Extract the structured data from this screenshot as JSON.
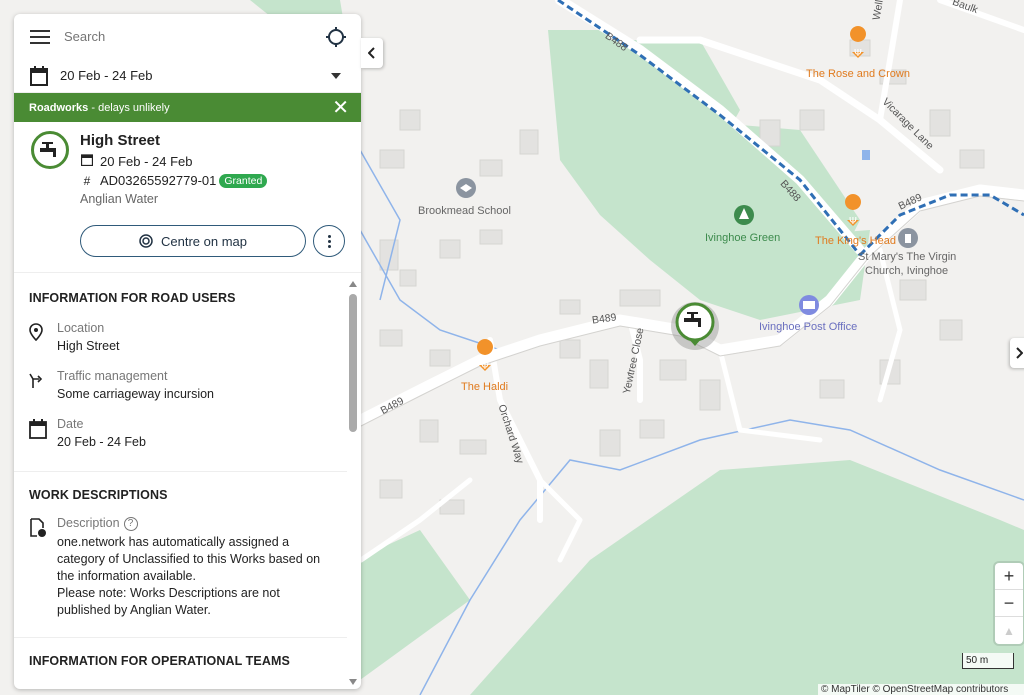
{
  "search": {
    "placeholder": "Search"
  },
  "date_filter": {
    "value": "20 Feb - 24 Feb"
  },
  "banner": {
    "title": "Roadworks",
    "subtitle": " - delays unlikely"
  },
  "works": {
    "street": "High Street",
    "dates": "20 Feb - 24 Feb",
    "reference": "AD03265592779-01",
    "status": "Granted",
    "company": "Anglian Water",
    "centre_button": "Centre on map"
  },
  "road_users": {
    "title": "INFORMATION FOR ROAD USERS",
    "location_label": "Location",
    "location_value": "High Street",
    "traffic_label": "Traffic management",
    "traffic_value": "Some carriageway incursion",
    "date_label": "Date",
    "date_value": "20 Feb - 24 Feb"
  },
  "work_descriptions": {
    "title": "WORK DESCRIPTIONS",
    "label": "Description",
    "help": "?",
    "text_1": "one.network has automatically assigned a category of Unclassified to this Works based on the information available.",
    "text_2": "Please note: Works Descriptions are not published by Anglian Water."
  },
  "operational": {
    "title": "INFORMATION FOR OPERATIONAL TEAMS"
  },
  "map": {
    "labels": {
      "b488_top": "B488",
      "b488_mid": "B488",
      "b489_right": "B489",
      "b489_center": "B489",
      "b489_left": "B489",
      "baulk": "Baulk",
      "well": "Well",
      "vicarage_lane": "Vicarage Lane",
      "rose_crown": "The Rose and Crown",
      "kings_head": "The King's Head",
      "brookmead": "Brookmead School",
      "ivinghoe_green": "Ivinghoe Green",
      "st_marys_1": "St Mary's The Virgin",
      "st_marys_2": "Church, Ivinghoe",
      "post_office": "Ivinghoe Post Office",
      "haldi": "The Haldi",
      "yewtree": "Yewtree Close",
      "orchard": "Orchard Way"
    },
    "zoom_in": "+",
    "zoom_out": "−",
    "compass": "▲",
    "scale": "50 m",
    "attribution": "© MapTiler © OpenStreetMap contributors",
    "colors": {
      "green_area": "#c5e4cc",
      "road": "#ffffff",
      "water": "#8fb4ea",
      "border": "#2f6fb5",
      "poi_orange": "#e07b1f"
    }
  }
}
